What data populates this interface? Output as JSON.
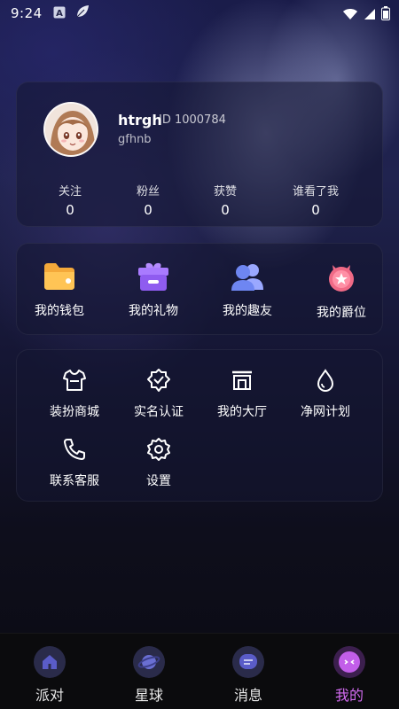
{
  "status_bar": {
    "time": "9:24",
    "left_icons": [
      "a-icon",
      "leaf-icon"
    ],
    "right_icons": [
      "wifi-icon",
      "signal-icon",
      "battery-icon"
    ]
  },
  "profile": {
    "username": "htrgh",
    "user_id": "ID 1000784",
    "signature": "gfhnb",
    "stats": [
      {
        "label": "关注",
        "value": "0"
      },
      {
        "label": "粉丝",
        "value": "0"
      },
      {
        "label": "获赞",
        "value": "0"
      },
      {
        "label": "谁看了我",
        "value": "0"
      }
    ]
  },
  "assets": [
    {
      "label": "我的钱包",
      "icon": "wallet-icon"
    },
    {
      "label": "我的礼物",
      "icon": "gift-icon"
    },
    {
      "label": "我的趣友",
      "icon": "friends-icon"
    },
    {
      "label": "我的爵位",
      "icon": "medal-icon"
    }
  ],
  "menu": [
    {
      "label": "装扮商城",
      "icon": "shirt-icon"
    },
    {
      "label": "实名认证",
      "icon": "verified-icon"
    },
    {
      "label": "我的大厅",
      "icon": "hall-icon"
    },
    {
      "label": "净网计划",
      "icon": "drop-icon"
    },
    {
      "label": "联系客服",
      "icon": "phone-icon"
    },
    {
      "label": "设置",
      "icon": "settings-icon"
    }
  ],
  "tabs": [
    {
      "label": "派对",
      "icon": "house-icon",
      "active": false
    },
    {
      "label": "星球",
      "icon": "planet-icon",
      "active": false
    },
    {
      "label": "消息",
      "icon": "message-icon",
      "active": false
    },
    {
      "label": "我的",
      "icon": "face-icon",
      "active": true
    }
  ],
  "colors": {
    "accent": "#d46cf2",
    "wallet": "#f4a93a",
    "gift": "#8f5cf0",
    "friends": "#6e86f2",
    "medal": "#f06a86"
  }
}
